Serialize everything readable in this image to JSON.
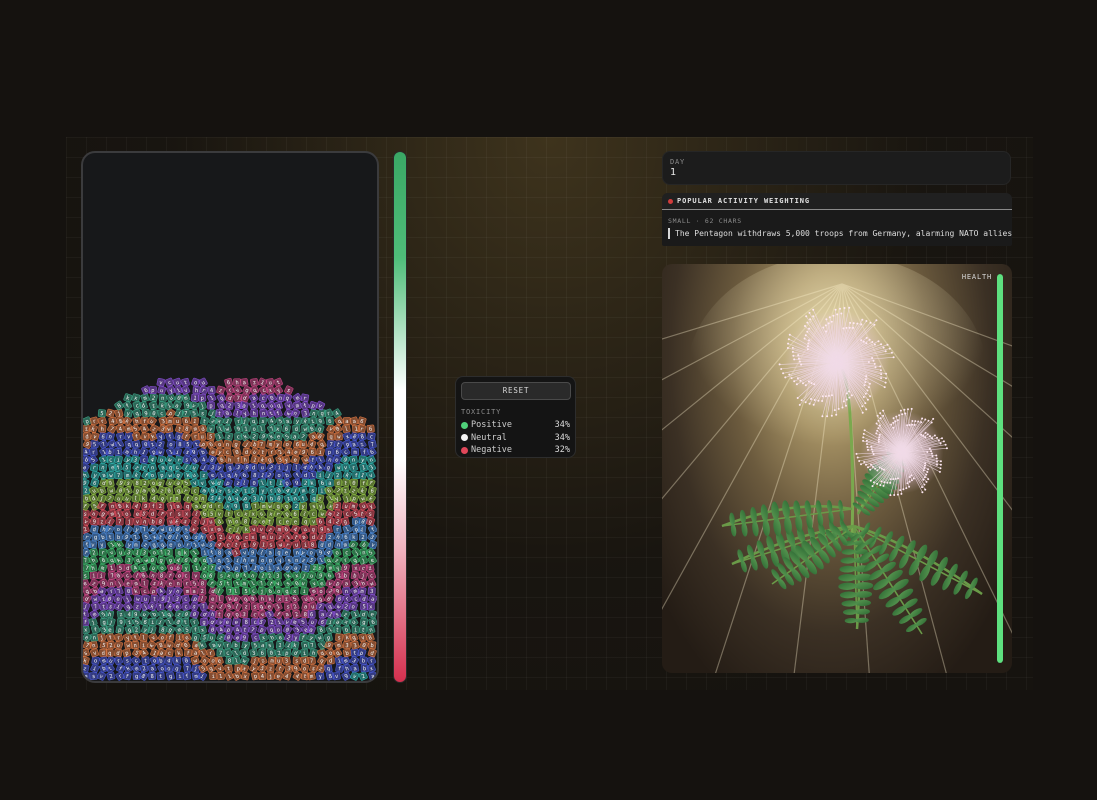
{
  "controls": {
    "reset_label": "RESET",
    "toxicity_label": "TOXICITY",
    "items": [
      {
        "name": "Positive",
        "pct": "34%",
        "color": "#4fd07a"
      },
      {
        "name": "Neutral",
        "pct": "34%",
        "color": "#f2f2f2"
      },
      {
        "name": "Negative",
        "pct": "32%",
        "color": "#e0475a"
      }
    ]
  },
  "day": {
    "label": "DAY",
    "value": "1"
  },
  "activity": {
    "title": "POPULAR ACTIVITY WEIGHTING",
    "meta": "SMALL · 62 CHARS",
    "headline": "The Pentagon withdraws 5,000 troops from Germany, alarming NATO allies."
  },
  "plant": {
    "health_label": "HEALTH",
    "health_value": 1.0,
    "health_color": "#5ee07f"
  },
  "jar": {
    "band_colors": [
      "#8a52d8",
      "#3ea98a",
      "#e07a45",
      "#4a5ad8",
      "#2fb6b0",
      "#8fbf45",
      "#e04f5e",
      "#4f8fe0",
      "#3fbf70",
      "#d04888"
    ],
    "glyphs": "abcdefghijklmnopqrstuvwxyz0123456789"
  }
}
